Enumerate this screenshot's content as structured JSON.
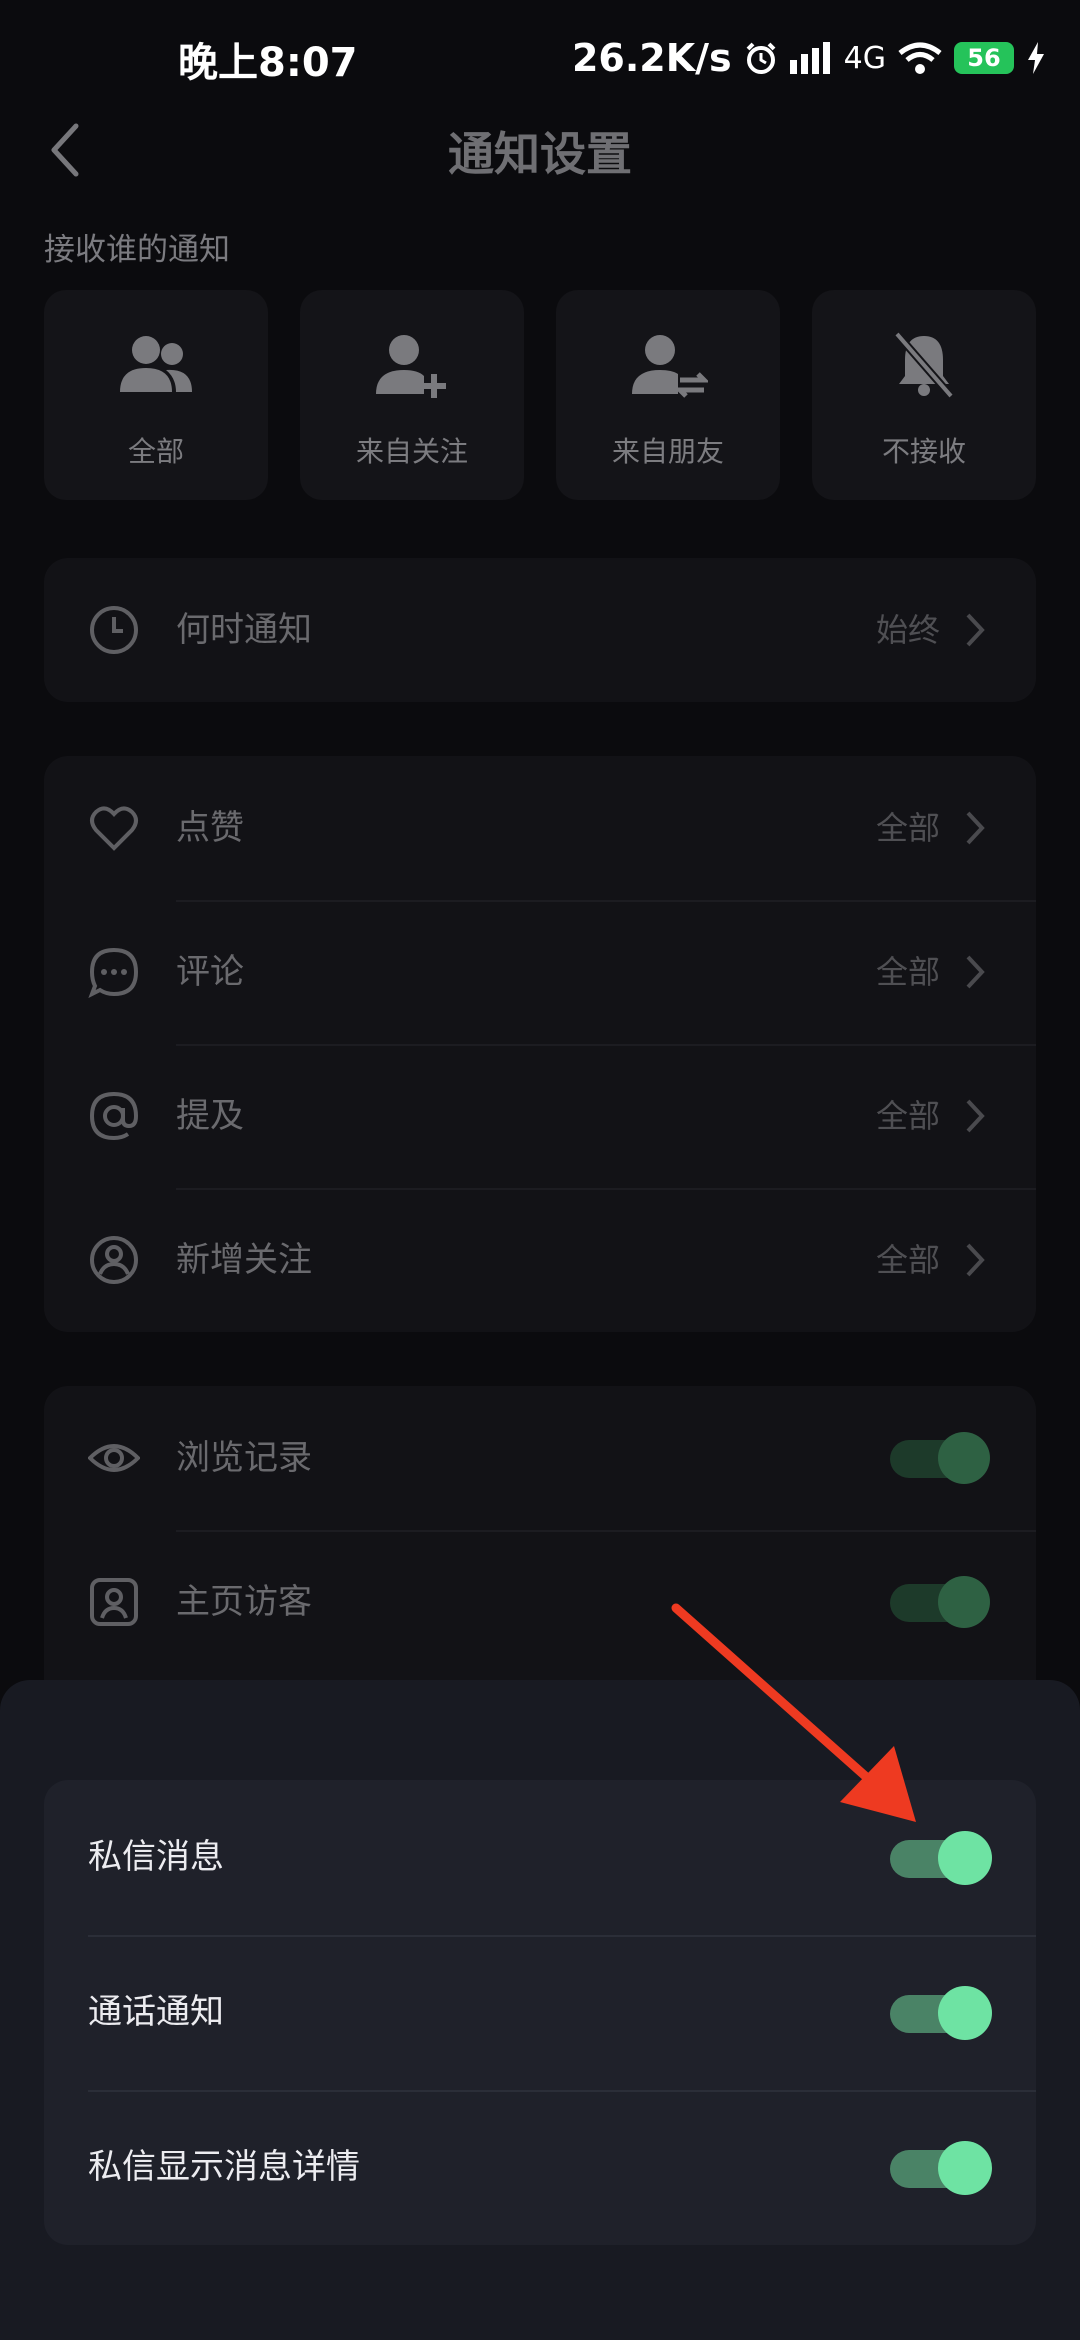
{
  "status_bar": {
    "time": "晚上8:07",
    "net_speed": "26.2K/s",
    "network": "4G",
    "battery": "56"
  },
  "header": {
    "title": "通知设置"
  },
  "audience": {
    "section_label": "接收谁的通知",
    "options": [
      {
        "label": "全部",
        "icon": "group-icon"
      },
      {
        "label": "来自关注",
        "icon": "person-add-icon"
      },
      {
        "label": "来自朋友",
        "icon": "person-swap-icon"
      },
      {
        "label": "不接收",
        "icon": "bell-off-icon"
      }
    ]
  },
  "schedule": {
    "label": "何时通知",
    "value": "始终",
    "icon": "clock-icon"
  },
  "activity": {
    "items": [
      {
        "label": "点赞",
        "value": "全部",
        "icon": "heart-icon"
      },
      {
        "label": "评论",
        "value": "全部",
        "icon": "comment-icon"
      },
      {
        "label": "提及",
        "value": "全部",
        "icon": "at-icon"
      },
      {
        "label": "新增关注",
        "value": "全部",
        "icon": "user-circle-icon"
      }
    ]
  },
  "toggles_bg": {
    "items": [
      {
        "label": "浏览记录",
        "icon": "eye-icon",
        "on": true
      },
      {
        "label": "主页访客",
        "icon": "profile-card-icon",
        "on": true
      }
    ]
  },
  "sheet": {
    "items": [
      {
        "label": "私信消息",
        "on": true
      },
      {
        "label": "通话通知",
        "on": true
      },
      {
        "label": "私信显示消息详情",
        "on": true
      }
    ]
  },
  "colors": {
    "background": "#0b0b0e",
    "sheet": "#181a22",
    "toggle_on": "#6ee3a3",
    "annotation_arrow": "#ee3a21"
  }
}
